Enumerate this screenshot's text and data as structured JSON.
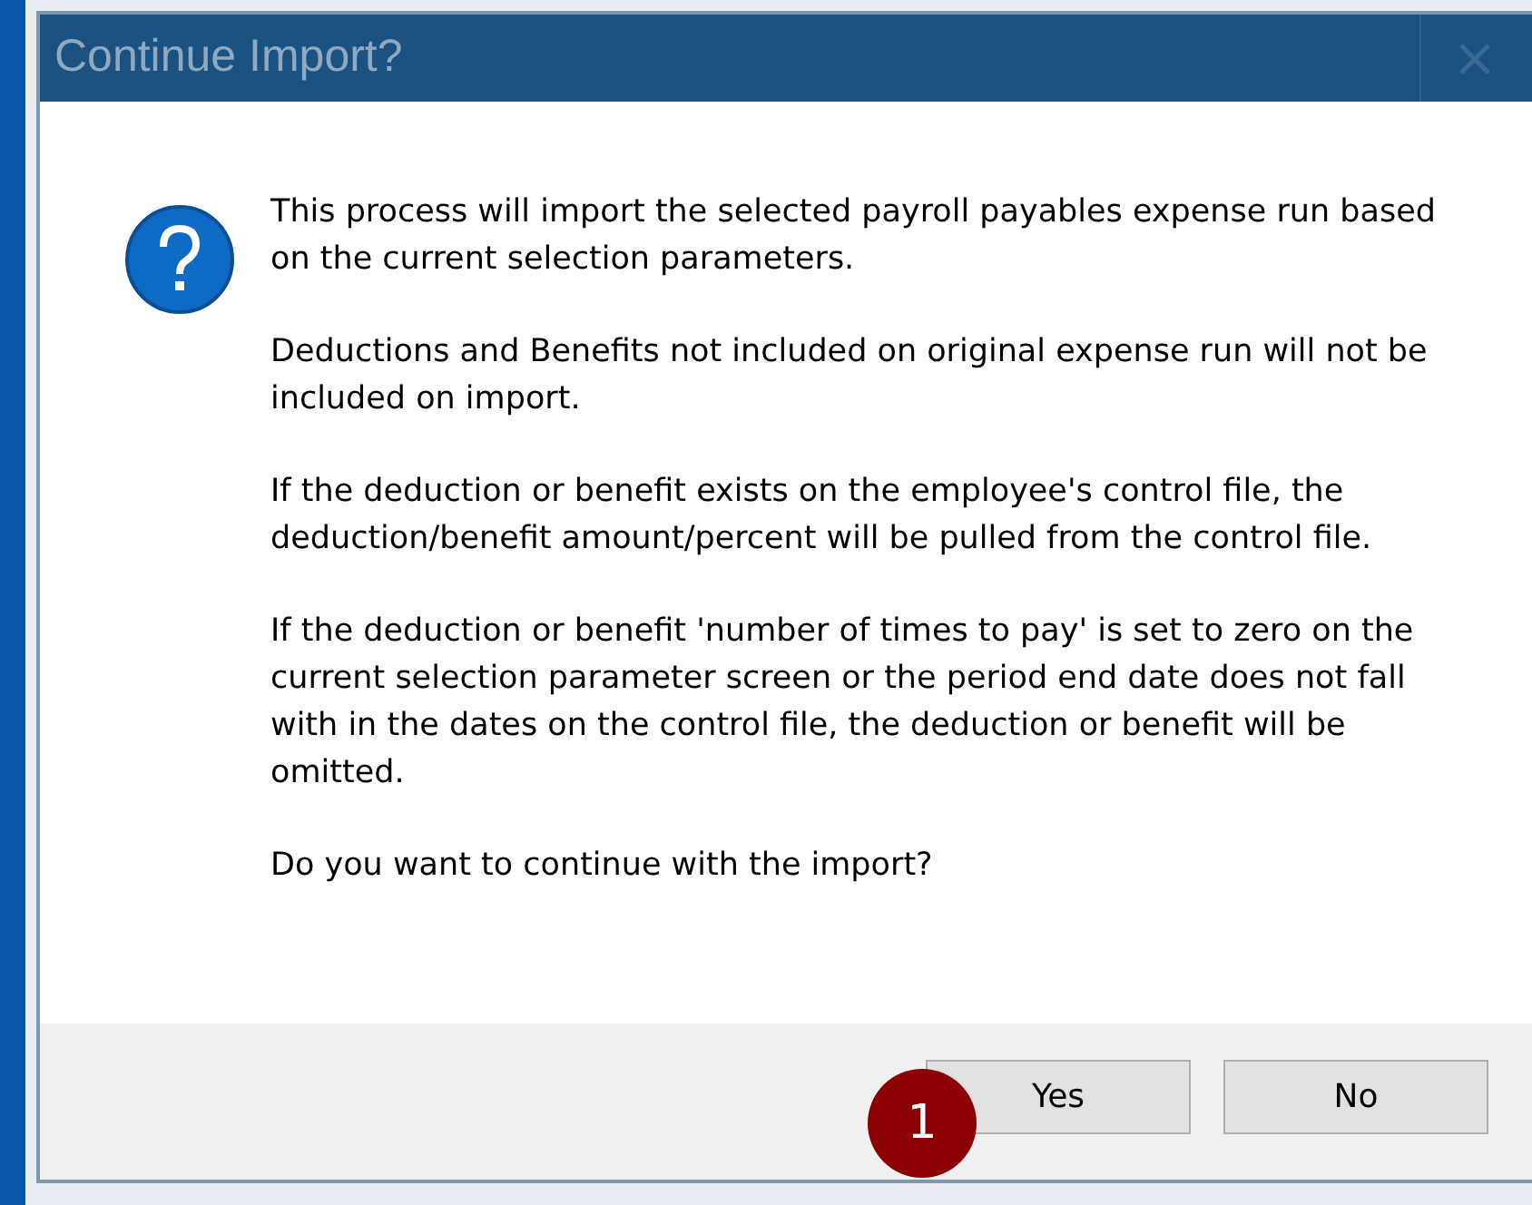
{
  "window": {
    "title": "Continue Import?",
    "close": "×"
  },
  "message": {
    "paragraphs": [
      "This process will import the selected payroll payables expense run based on the current selection parameters.",
      "Deductions and Benefits not included on original expense run will not be included on import.",
      "If the deduction or benefit exists on the employee's control file, the deduction/benefit amount/percent will be pulled from the control file.",
      "If the deduction or benefit 'number of times to pay' is set to zero on the current selection parameter screen or the period end date does not fall with in the dates on the control file, the deduction or benefit will be omitted.",
      "Do you want to continue with the import?"
    ]
  },
  "buttons": [
    {
      "label": "Yes"
    },
    {
      "label": "No"
    }
  ],
  "callout": {
    "label": "1"
  }
}
